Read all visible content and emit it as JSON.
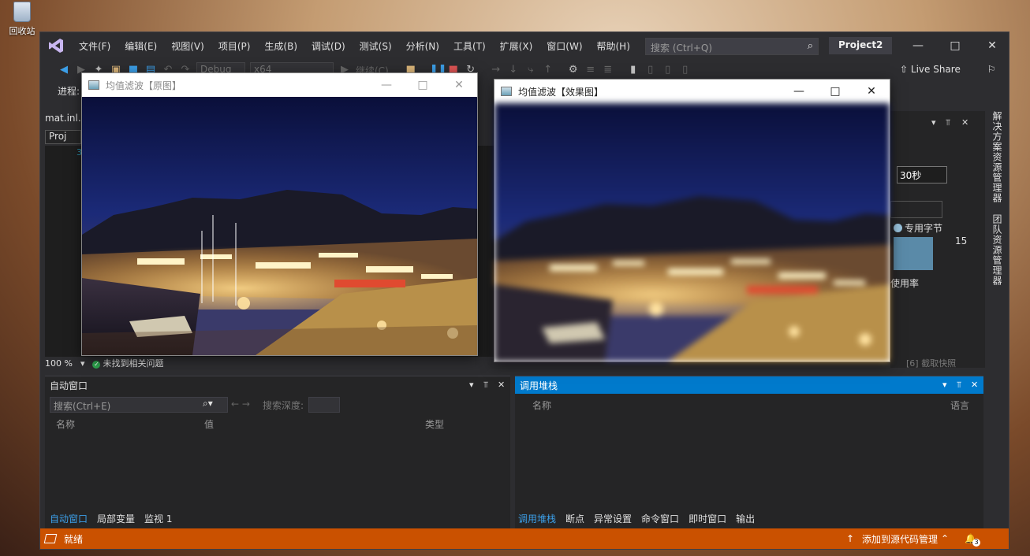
{
  "desktop": {
    "recycle_bin_label": "回收站"
  },
  "vs": {
    "menu": [
      "文件(F)",
      "编辑(E)",
      "视图(V)",
      "项目(P)",
      "生成(B)",
      "调试(D)",
      "测试(S)",
      "分析(N)",
      "工具(T)",
      "扩展(X)",
      "窗口(W)",
      "帮助(H)"
    ],
    "search_placeholder": "搜索 (Ctrl+Q)",
    "project_name": "Project2",
    "toolbar": {
      "config": "Debug",
      "platform": "x64",
      "continue_label": "继续(C)"
    },
    "live_share": "Live Share",
    "process_label": "进程:",
    "doc_tab": "mat.inl.",
    "doc_tab2": "Proj",
    "line_number": "3",
    "zoom": "100 %",
    "no_issues": "未找到相关问题",
    "right_panel": {
      "interval": "30秒",
      "legend": "专用字节",
      "value": "15",
      "usage": "使用率",
      "snapshot": "[6] 截取快照"
    },
    "side_tabs": [
      "解决方案资源管理器",
      "团队资源管理器"
    ],
    "autos": {
      "title": "自动窗口",
      "search_placeholder": "搜索(Ctrl+E)",
      "depth_label": "搜索深度:",
      "columns": [
        "名称",
        "值",
        "类型"
      ],
      "tabs": [
        "自动窗口",
        "局部变量",
        "监视 1"
      ]
    },
    "callstack": {
      "title": "调用堆栈",
      "columns": [
        "名称",
        "语言"
      ],
      "tabs": [
        "调用堆栈",
        "断点",
        "异常设置",
        "命令窗口",
        "即时窗口",
        "输出"
      ]
    },
    "status": {
      "ready": "就绪",
      "source_control": "添加到源代码管理",
      "notifications": "3"
    }
  },
  "windows": {
    "original": {
      "title": "均值滤波【原图】"
    },
    "effect": {
      "title": "均值滤波【效果图】"
    }
  }
}
